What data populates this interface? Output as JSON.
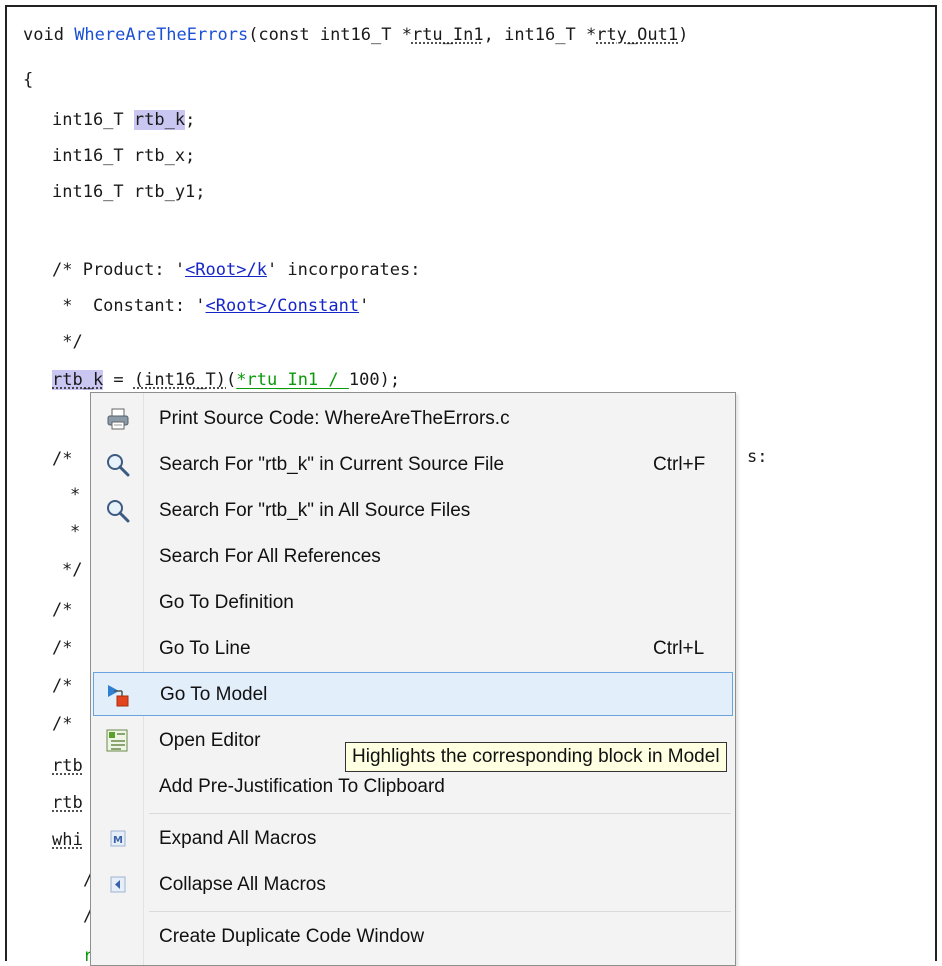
{
  "code": {
    "line1": {
      "void": "void ",
      "fn": "WhereAreTheErrors",
      "open": "(const int16_T *",
      "arg1": "rtu_In1",
      "mid": ", int16_T *",
      "arg2": "rty_Out1",
      "close": ")"
    },
    "line2": "{",
    "line3": {
      "type": "int16_T ",
      "var": "rtb_k",
      "end": ";"
    },
    "line4": "int16_T rtb_x;",
    "line5": "int16_T rtb_y1;",
    "line6": {
      "pre": "/* Product: '",
      "link": "<Root>/k",
      "post": "' incorporates:"
    },
    "line7": {
      "pre": " *  Constant: '",
      "link": "<Root>/Constant",
      "post": "'"
    },
    "line8": " */",
    "line9": {
      "var": "rtb_k",
      "eq": " = ",
      "cast": "(int16_T)",
      "sp": "(",
      "in": "*rtu_In1",
      "div": " / ",
      "num": "100",
      "end": ");"
    },
    "line10_tail": "s:",
    "frag_comment": "/*",
    "frag_star": "*",
    "frag_end": "*/",
    "frag_rtb": "rtb",
    "frag_whi": "whi",
    "frag_slash": "/",
    "frag_r": "r"
  },
  "menu": {
    "items": [
      {
        "label": "Print Source Code: WhereAreTheErrors.c",
        "shortcut": "",
        "icon": "printer-icon"
      },
      {
        "label": "Search For \"rtb_k\" in Current Source File",
        "shortcut": "Ctrl+F",
        "icon": "magnifier-icon"
      },
      {
        "label": "Search For \"rtb_k\" in All Source Files",
        "shortcut": "",
        "icon": "magnifier-icon"
      },
      {
        "label": "Search For All References",
        "shortcut": "",
        "icon": ""
      },
      {
        "label": "Go To Definition",
        "shortcut": "",
        "icon": ""
      },
      {
        "label": "Go To Line",
        "shortcut": "Ctrl+L",
        "icon": ""
      },
      {
        "label": "Go To Model",
        "shortcut": "",
        "icon": "go-to-model-icon"
      },
      {
        "label": "Open Editor",
        "shortcut": "",
        "icon": "editor-icon"
      },
      {
        "label": "Add Pre-Justification To Clipboard",
        "shortcut": "",
        "icon": ""
      },
      {
        "label": "Expand All Macros",
        "shortcut": "",
        "icon": "expand-macro-icon"
      },
      {
        "label": "Collapse All Macros",
        "shortcut": "",
        "icon": "collapse-macro-icon"
      },
      {
        "label": "Create Duplicate Code Window",
        "shortcut": "",
        "icon": ""
      }
    ]
  },
  "tooltip": "Highlights the corresponding block in Model"
}
